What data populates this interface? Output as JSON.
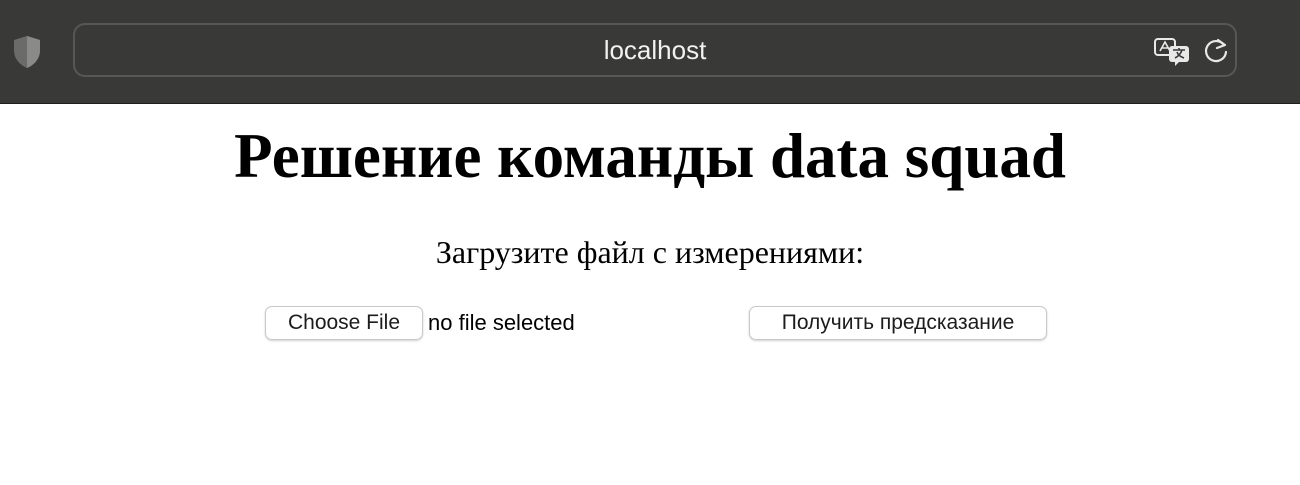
{
  "browser": {
    "address": "localhost",
    "icons": [
      "shield-icon",
      "translate-icon",
      "reload-icon"
    ]
  },
  "page": {
    "title": "Решение команды data squad",
    "prompt": "Загрузите файл с измерениями:",
    "file_input": {
      "button_label": "Choose File",
      "status": "no file selected"
    },
    "predict_button_label": "Получить предсказание"
  },
  "colors": {
    "toolbar_bg": "#393938",
    "address_border": "#575755",
    "page_bg": "#ffffff"
  }
}
